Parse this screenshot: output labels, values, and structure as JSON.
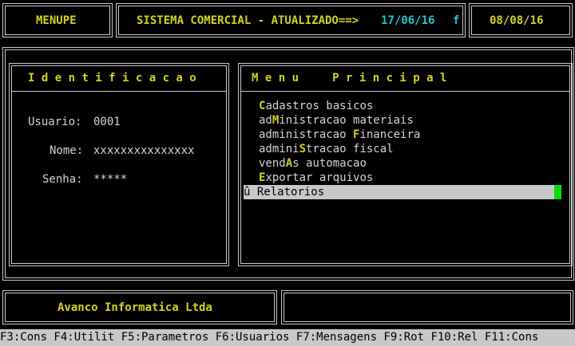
{
  "header": {
    "app_name": "MENUPE",
    "system_title": "SISTEMA COMERCIAL - ATUALIZADO==>",
    "updated_date": "17/06/16",
    "flag": "f",
    "current_date": "08/08/16"
  },
  "identification": {
    "title": "I d e n t i f i c a c a o",
    "user_label": "Usuario:",
    "user_value": "0001",
    "name_label": "Nome:",
    "name_value": "xxxxxxxxxxxxxxx",
    "password_label": "Senha:",
    "password_value": "*****"
  },
  "menu": {
    "title": "M e n u     P r i n c i p a l",
    "items": [
      {
        "pre": "",
        "hot": "C",
        "post": "adastros basicos"
      },
      {
        "pre": "ad",
        "hot": "M",
        "post": "inistracao materiais"
      },
      {
        "pre": "administracao ",
        "hot": "F",
        "post": "inanceira"
      },
      {
        "pre": "admini",
        "hot": "S",
        "post": "tracao fiscal"
      },
      {
        "pre": "vend",
        "hot": "A",
        "post": "s automacao"
      },
      {
        "pre": "",
        "hot": "E",
        "post": "xportar arquivos"
      }
    ],
    "selected_marker": "û",
    "selected_label": "Relatorios"
  },
  "footer": {
    "company": "Avanco Informatica Ltda",
    "function_keys": "F3:Cons F4:Utilit F5:Parametros F6:Usuarios F7:Mensagens F9:Rot F10:Rel F11:Cons"
  },
  "colors": {
    "background": "#000000",
    "border": "#c8c8c8",
    "highlight_text": "#d2d21e",
    "date_text": "#26c4cf",
    "cursor": "#00dd00"
  }
}
